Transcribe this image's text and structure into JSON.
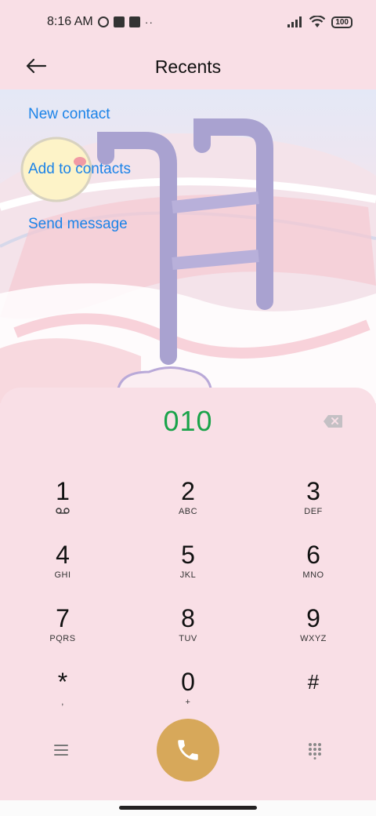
{
  "status_bar": {
    "time": "8:16 AM",
    "battery": "100"
  },
  "app_bar": {
    "title": "Recents"
  },
  "actions": [
    {
      "label": "New contact"
    },
    {
      "label": "Add to contacts"
    },
    {
      "label": "Send message"
    }
  ],
  "dialpad": {
    "number": "010",
    "keys": [
      {
        "digit": "1",
        "letters": "voicemail"
      },
      {
        "digit": "2",
        "letters": "ABC"
      },
      {
        "digit": "3",
        "letters": "DEF"
      },
      {
        "digit": "4",
        "letters": "GHI"
      },
      {
        "digit": "5",
        "letters": "JKL"
      },
      {
        "digit": "6",
        "letters": "MNO"
      },
      {
        "digit": "7",
        "letters": "PQRS"
      },
      {
        "digit": "8",
        "letters": "TUV"
      },
      {
        "digit": "9",
        "letters": "WXYZ"
      },
      {
        "digit": "*",
        "letters": ","
      },
      {
        "digit": "0",
        "letters": "+"
      },
      {
        "digit": "#",
        "letters": ""
      }
    ]
  },
  "colors": {
    "accent_link": "#1b83e8",
    "number": "#1aa34a",
    "call_button": "#d7a85a",
    "background": "#f9dfe6"
  },
  "icons": {
    "back": "arrow-left-icon",
    "backspace": "backspace-icon",
    "menu": "menu-icon",
    "call": "phone-icon",
    "dialpad_toggle": "dialpad-grid-icon"
  }
}
